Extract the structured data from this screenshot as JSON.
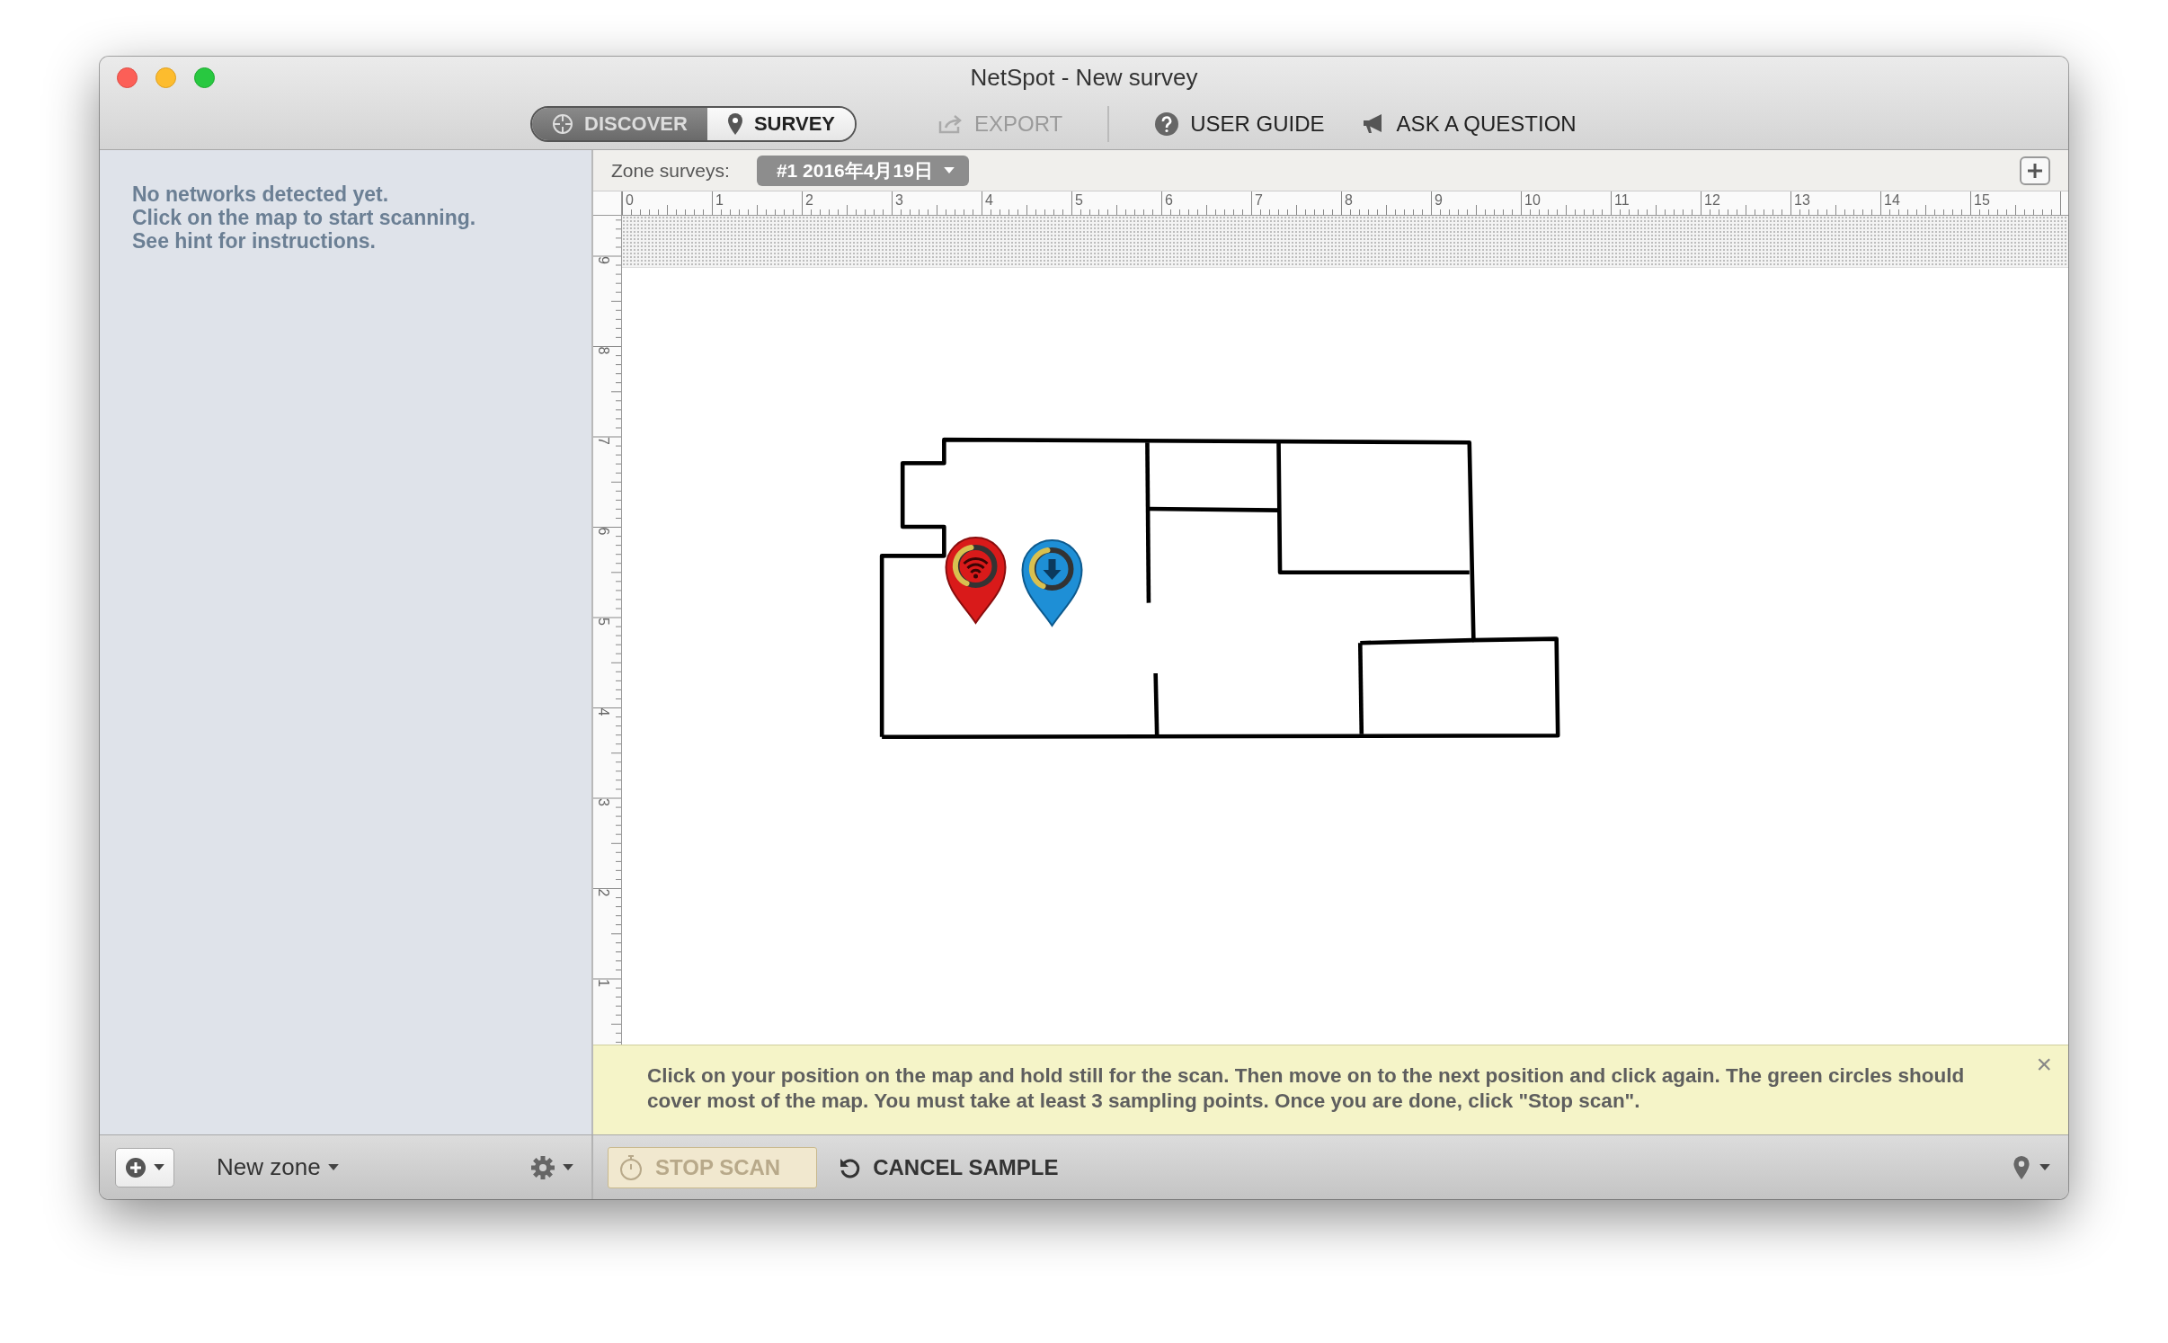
{
  "window": {
    "title": "NetSpot - New survey"
  },
  "toolbar": {
    "modes": [
      {
        "label": "DISCOVER",
        "selected": false,
        "kind": "discover"
      },
      {
        "label": "SURVEY",
        "selected": true,
        "kind": "survey"
      }
    ],
    "actions": [
      {
        "label": "EXPORT",
        "disabled": true,
        "kind": "export"
      },
      {
        "label": "USER GUIDE",
        "disabled": false,
        "kind": "help"
      },
      {
        "label": "ASK A QUESTION",
        "disabled": false,
        "kind": "megaphone"
      }
    ]
  },
  "sidebar": {
    "message": [
      "No networks detected yet.",
      "Click on the map to start scanning.",
      "See hint for instructions."
    ]
  },
  "zone_bar": {
    "label": "Zone surveys:",
    "survey": "#1 2016年4月19日"
  },
  "ruler": {
    "x_labels": [
      "0",
      "1",
      "2",
      "3",
      "4",
      "5",
      "6",
      "7",
      "8",
      "9",
      "10",
      "11",
      "12",
      "13",
      "14",
      "15"
    ],
    "y_labels": [
      "9",
      "8",
      "7",
      "6",
      "5",
      "4",
      "3",
      "2",
      "1"
    ]
  },
  "map": {
    "pins": [
      {
        "kind": "wifi"
      },
      {
        "kind": "download"
      }
    ]
  },
  "hint": {
    "text": "Click on your position on the map and hold still for the scan. Then move on to the next position and click again. The green circles should cover most of the map. You must take at least 3 sampling points. Once you are done, click \"Stop scan\".",
    "close": "×"
  },
  "bottom_bar": {
    "zone_menu": "New zone",
    "stop_scan": {
      "label": "STOP SCAN",
      "disabled": true
    },
    "cancel": "CANCEL SAMPLE"
  }
}
